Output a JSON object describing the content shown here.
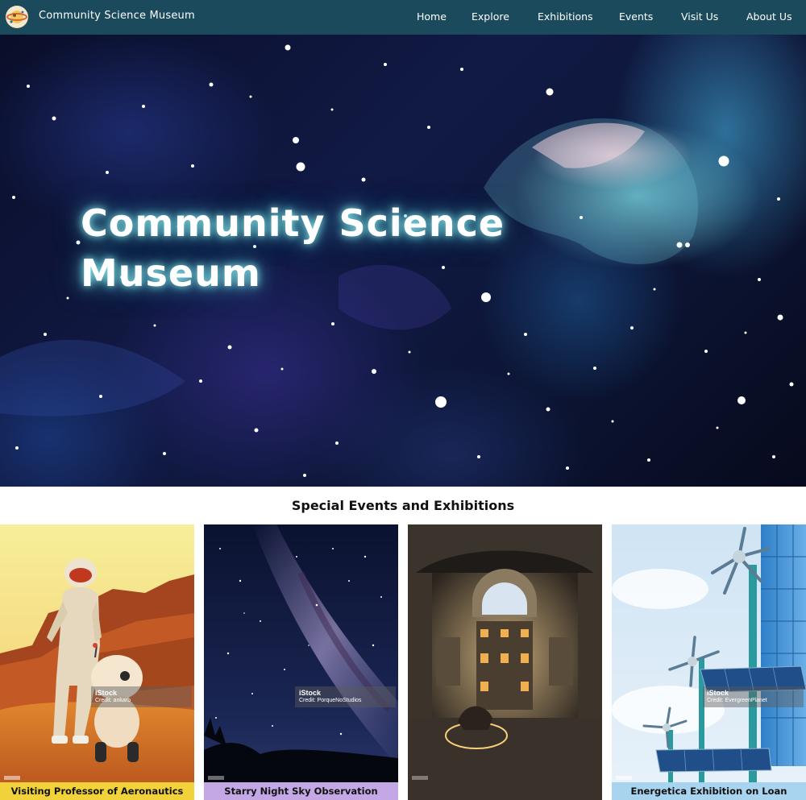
{
  "header": {
    "site_name": "Community Science Museum",
    "logo_icon": "planet-logo-icon",
    "nav": [
      "Home",
      "Explore",
      "Exhibitions",
      "Events",
      "Visit Us",
      "About Us"
    ]
  },
  "hero": {
    "title_line1": "Community Science",
    "title_line2": "Museum"
  },
  "events_section": {
    "title": "Special Events and Exhibitions",
    "cards": [
      {
        "caption": "Visiting Professor of Aeronautics",
        "watermark_brand": "iStock",
        "watermark_credit": "Credit: ankarb",
        "caption_bg": "#f2d23a",
        "image": "astronaut-and-robot-on-mars-image"
      },
      {
        "caption": "Starry Night Sky Observation",
        "watermark_brand": "iStock",
        "watermark_credit": "Credit: PorqueNoStudios",
        "caption_bg": "#c4a8e6",
        "image": "milky-way-night-sky-image"
      },
      {
        "caption": "",
        "watermark_brand": "",
        "watermark_credit": "",
        "caption_bg": "",
        "image": "museum-rotunda-interior-image"
      },
      {
        "caption": "Energetica Exhibition on Loan",
        "watermark_brand": "iStock",
        "watermark_credit": "Credit: EvergreenPlanet",
        "caption_bg": "#a9d4ef",
        "image": "wind-turbines-and-solar-panels-image"
      }
    ]
  },
  "colors": {
    "nav_bg": "#1b4a5c",
    "hero_glow": "#8cf0f0"
  }
}
